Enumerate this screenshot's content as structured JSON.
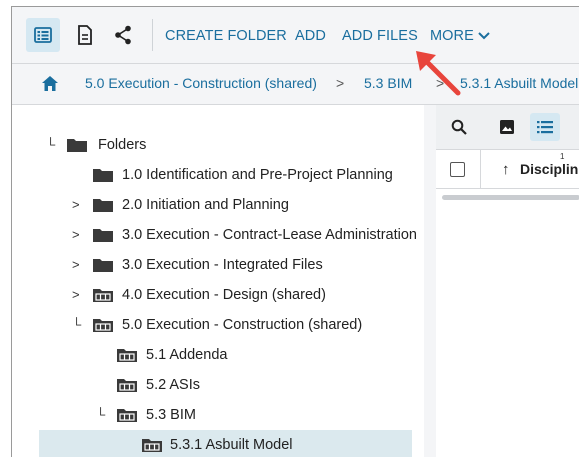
{
  "toolbar": {
    "view_icon": "list-view-icon",
    "doc_icon": "document-icon",
    "share_icon": "share-icon",
    "actions": {
      "create_folder": "CREATE FOLDER",
      "add": "ADD",
      "add_files": "ADD FILES",
      "more": "MORE"
    }
  },
  "breadcrumb": {
    "home_icon": "home-icon",
    "items": [
      "5.0 Execution - Construction (shared)",
      "5.3 BIM",
      "5.3.1 Asbuilt Model"
    ],
    "separator": ">"
  },
  "tree": {
    "root": {
      "toggle": "└",
      "label": "Folders"
    },
    "rows": [
      {
        "toggle": "",
        "label": "1.0 Identification and Pre-Project Planning",
        "shared": false
      },
      {
        "toggle": ">",
        "label": "2.0 Initiation and Planning",
        "shared": false
      },
      {
        "toggle": ">",
        "label": "3.0 Execution - Contract-Lease Administration",
        "shared": false
      },
      {
        "toggle": ">",
        "label": "3.0 Execution - Integrated Files",
        "shared": false
      },
      {
        "toggle": ">",
        "label": "4.0 Execution - Design (shared)",
        "shared": true
      },
      {
        "toggle": "└",
        "label": "5.0 Execution - Construction (shared)",
        "shared": true
      },
      {
        "toggle": "",
        "label": "5.1 Addenda",
        "shared": true
      },
      {
        "toggle": "",
        "label": "5.2 ASIs",
        "shared": true
      },
      {
        "toggle": "└",
        "label": "5.3 BIM",
        "shared": true
      },
      {
        "toggle": "",
        "label": "5.3.1 Asbuilt Model",
        "shared": true,
        "selected": true
      }
    ]
  },
  "right_panel": {
    "search_icon": "search-icon",
    "image_icon": "image-view-icon",
    "list_icon": "list-view-icon",
    "sort_number": "1",
    "sort_arrow": "↑",
    "column_label": "Disciplin"
  },
  "colors": {
    "accent": "#1a6e9e",
    "annotation": "#e8453c",
    "selected_row": "#dbe9ee",
    "active_icon_bg": "#d5e8f2"
  }
}
